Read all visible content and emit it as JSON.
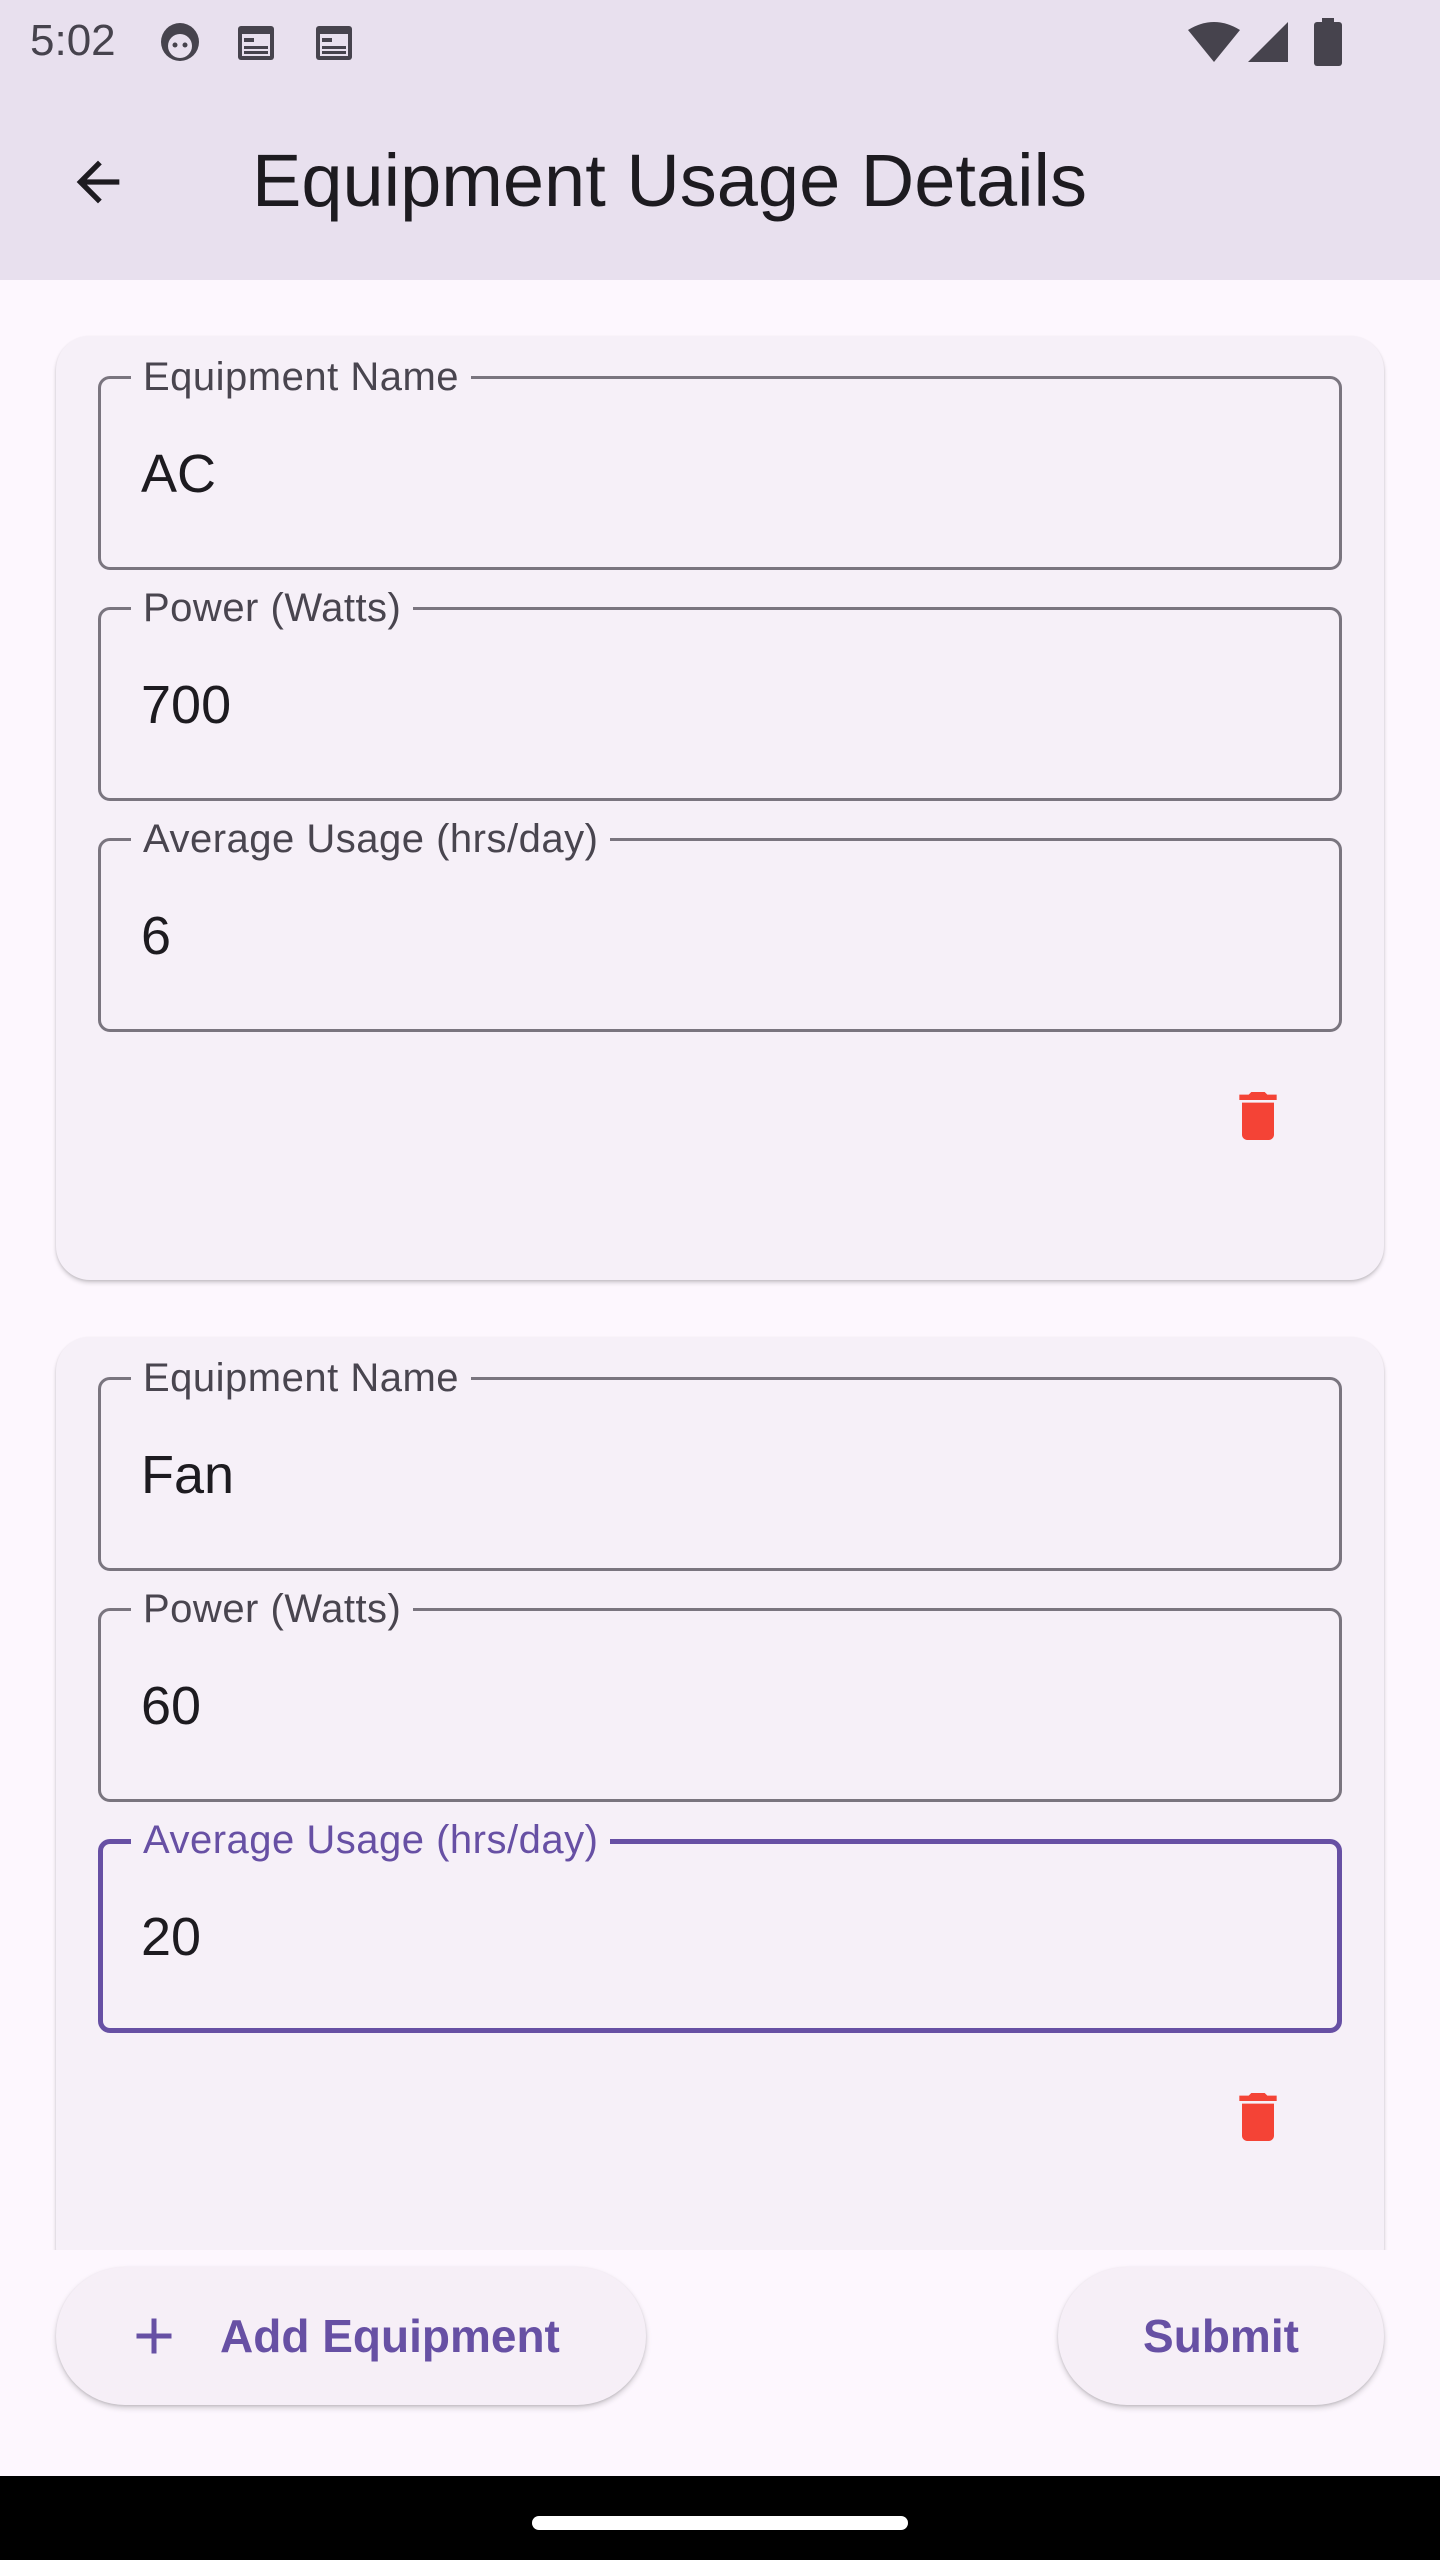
{
  "status_bar": {
    "time": "5:02",
    "left_icons": [
      "android-debug-icon",
      "calendar-icon",
      "calendar-icon"
    ],
    "right_icons": [
      "wifi-icon",
      "signal-icon",
      "battery-icon"
    ]
  },
  "app_bar": {
    "title": "Equipment Usage Details",
    "back_icon": "arrow-back-icon"
  },
  "equipment": [
    {
      "name_label": "Equipment Name",
      "name_value": "AC",
      "power_label": "Power (Watts)",
      "power_value": "700",
      "usage_label": "Average Usage (hrs/day)",
      "usage_value": "6",
      "delete_icon": "trash-icon"
    },
    {
      "name_label": "Equipment Name",
      "name_value": "Fan",
      "power_label": "Power (Watts)",
      "power_value": "60",
      "usage_label": "Average Usage (hrs/day)",
      "usage_value": "20",
      "delete_icon": "trash-icon"
    }
  ],
  "actions": {
    "add_label": "Add Equipment",
    "submit_label": "Submit"
  },
  "colors": {
    "accent": "#6750a4",
    "delete": "#f44336",
    "app_bar_bg": "#e8e0ee",
    "card_bg": "#f6f0f8"
  }
}
